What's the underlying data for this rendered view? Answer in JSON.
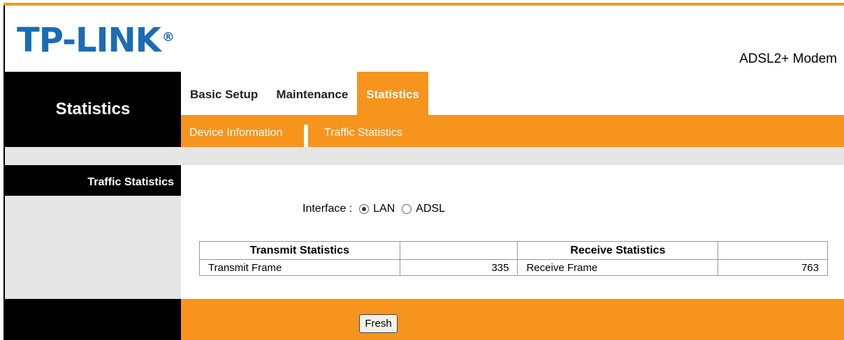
{
  "header": {
    "brand": "TP-LINK",
    "registered_mark": "®",
    "model": "ADSL2+ Modem"
  },
  "left": {
    "section_title": "Statistics",
    "menu_item": "Traffic Statistics"
  },
  "tabs": [
    {
      "label": "Basic Setup",
      "active": false
    },
    {
      "label": "Maintenance",
      "active": false
    },
    {
      "label": "Statistics",
      "active": true
    }
  ],
  "subnav": [
    {
      "label": "Device Information"
    },
    {
      "label": "Traffic Statistics"
    }
  ],
  "interface": {
    "label": "Interface :",
    "options": [
      {
        "label": "LAN",
        "checked": true
      },
      {
        "label": "ADSL",
        "checked": false
      }
    ]
  },
  "table": {
    "headers": [
      "Transmit Statistics",
      "",
      "Receive Statistics",
      ""
    ],
    "rows": [
      [
        "Transmit Frame",
        "335",
        "Receive Frame",
        "763"
      ]
    ]
  },
  "actions": {
    "fresh_label": "Fresh"
  },
  "colors": {
    "accent": "#f7941d",
    "brand": "#1a6cb5",
    "sidebar": "#000000",
    "panel_gray": "#e6e6e6"
  }
}
